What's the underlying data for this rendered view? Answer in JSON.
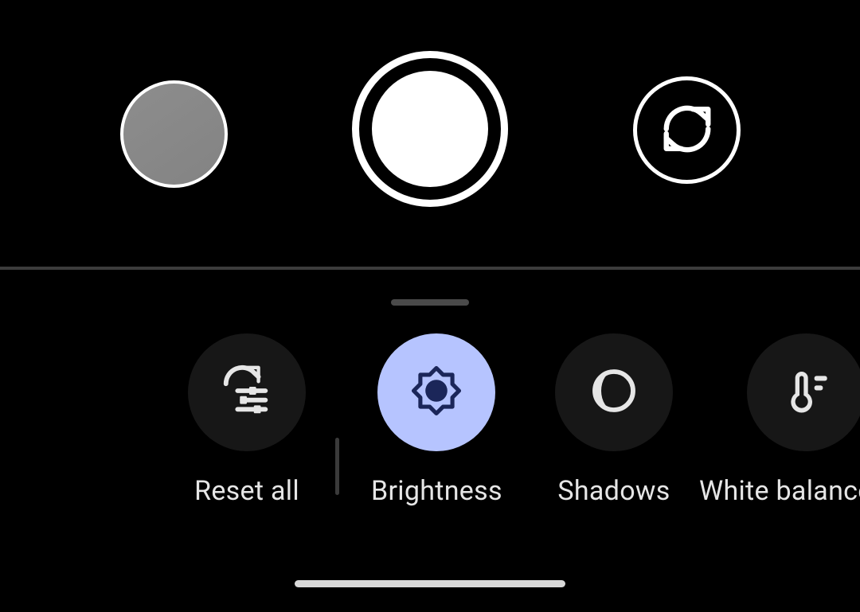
{
  "top": {
    "gallery": "gallery-thumbnail",
    "shutter": "shutter-button",
    "switch": "switch-camera"
  },
  "tools": {
    "reset": {
      "label": "Reset all",
      "icon": "reset-sliders-icon",
      "selected": false
    },
    "bright": {
      "label": "Brightness",
      "icon": "brightness-icon",
      "selected": true
    },
    "shadows": {
      "label": "Shadows",
      "icon": "shadows-icon",
      "selected": false
    },
    "wb": {
      "label": "White balance",
      "icon": "thermometer-icon",
      "selected": false
    }
  }
}
